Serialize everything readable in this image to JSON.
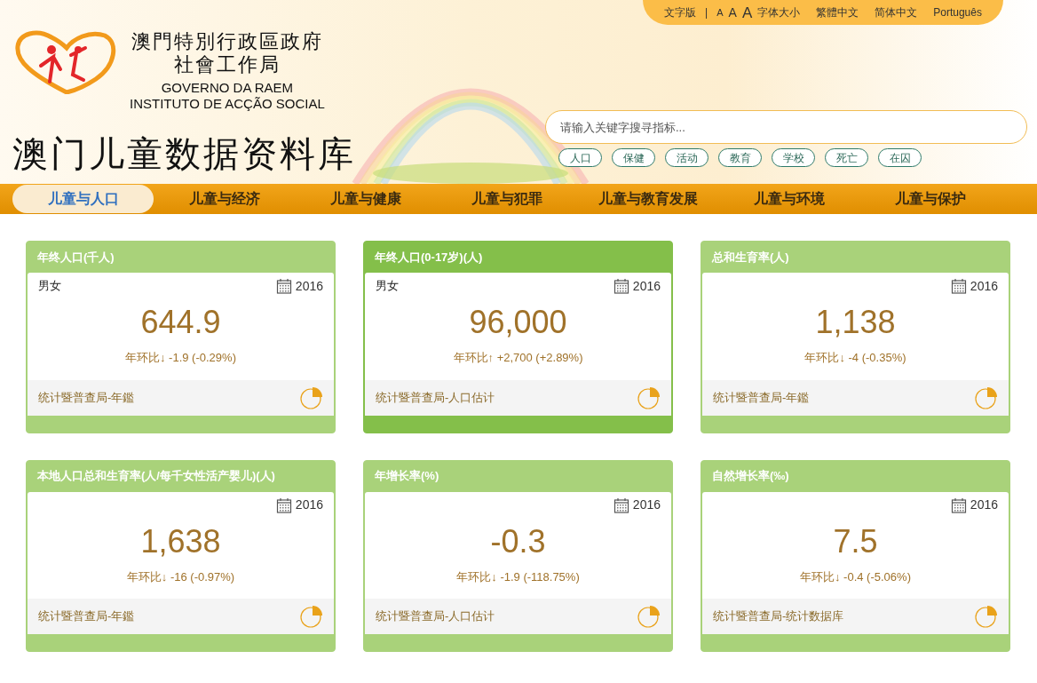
{
  "top_links": [
    {
      "kind": "link",
      "label": "文字版"
    },
    {
      "kind": "separator",
      "label": "|"
    },
    {
      "kind": "font-small",
      "label": "A"
    },
    {
      "kind": "font-medium",
      "label": "A"
    },
    {
      "kind": "font-large",
      "label": "A"
    },
    {
      "kind": "link",
      "label": "字体大小"
    },
    {
      "kind": "lang",
      "label": "繁體中文"
    },
    {
      "kind": "lang",
      "label": "简体中文"
    },
    {
      "kind": "lang",
      "label": "Português"
    }
  ],
  "org": {
    "lines": [
      "澳門特別行政區政府",
      "社會工作局",
      "GOVERNO DA RAEM",
      "INSTITUTO DE ACÇÃO SOCIAL"
    ]
  },
  "site_title": "澳门儿童数据资料库",
  "search": {
    "placeholder": "请输入关键字搜寻指标..."
  },
  "tags": [
    "人口",
    "保健",
    "活动",
    "教育",
    "学校",
    "死亡",
    "在囚"
  ],
  "nav": [
    {
      "label": "儿童与人口",
      "selected": true
    },
    {
      "label": "儿童与经济",
      "selected": false
    },
    {
      "label": "儿童与健康",
      "selected": false
    },
    {
      "label": "儿童与犯罪",
      "selected": false
    },
    {
      "label": "儿童与教育发展",
      "selected": false
    },
    {
      "label": "儿童与环境",
      "selected": false
    },
    {
      "label": "儿童与保护",
      "selected": false
    }
  ],
  "cards": [
    {
      "title": "年终人口(千人)",
      "subtitle": "男女",
      "year": "2016",
      "value": "644.9",
      "change": "年环比↓ -1.9 (-0.29%)",
      "source": "统计暨普查局-年鑑",
      "selected": false
    },
    {
      "title": "年终人口(0-17岁)(人)",
      "subtitle": "男女",
      "year": "2016",
      "value": "96,000",
      "change": "年环比↑ +2,700 (+2.89%)",
      "source": "统计暨普查局-人口估计",
      "selected": true
    },
    {
      "title": "总和生育率(人)",
      "year": "2016",
      "value": "1,138",
      "change": "年环比↓ -4 (-0.35%)",
      "source": "统计暨普查局-年鑑",
      "selected": false
    },
    {
      "title": "本地人口总和生育率(人/每千女性活产婴儿)(人)",
      "year": "2016",
      "value": "1,638",
      "change": "年环比↓ -16 (-0.97%)",
      "source": "统计暨普查局-年鑑",
      "selected": false
    },
    {
      "title": "年增长率(%)",
      "year": "2016",
      "value": "-0.3",
      "change": "年环比↓ -1.9 (-118.75%)",
      "source": "统计暨普查局-人口估计",
      "selected": false
    },
    {
      "title": "自然增长率(‰)",
      "year": "2016",
      "value": "7.5",
      "change": "年环比↓ -0.4 (-5.06%)",
      "source": "统计暨普查局-统计数据库",
      "selected": false
    }
  ]
}
